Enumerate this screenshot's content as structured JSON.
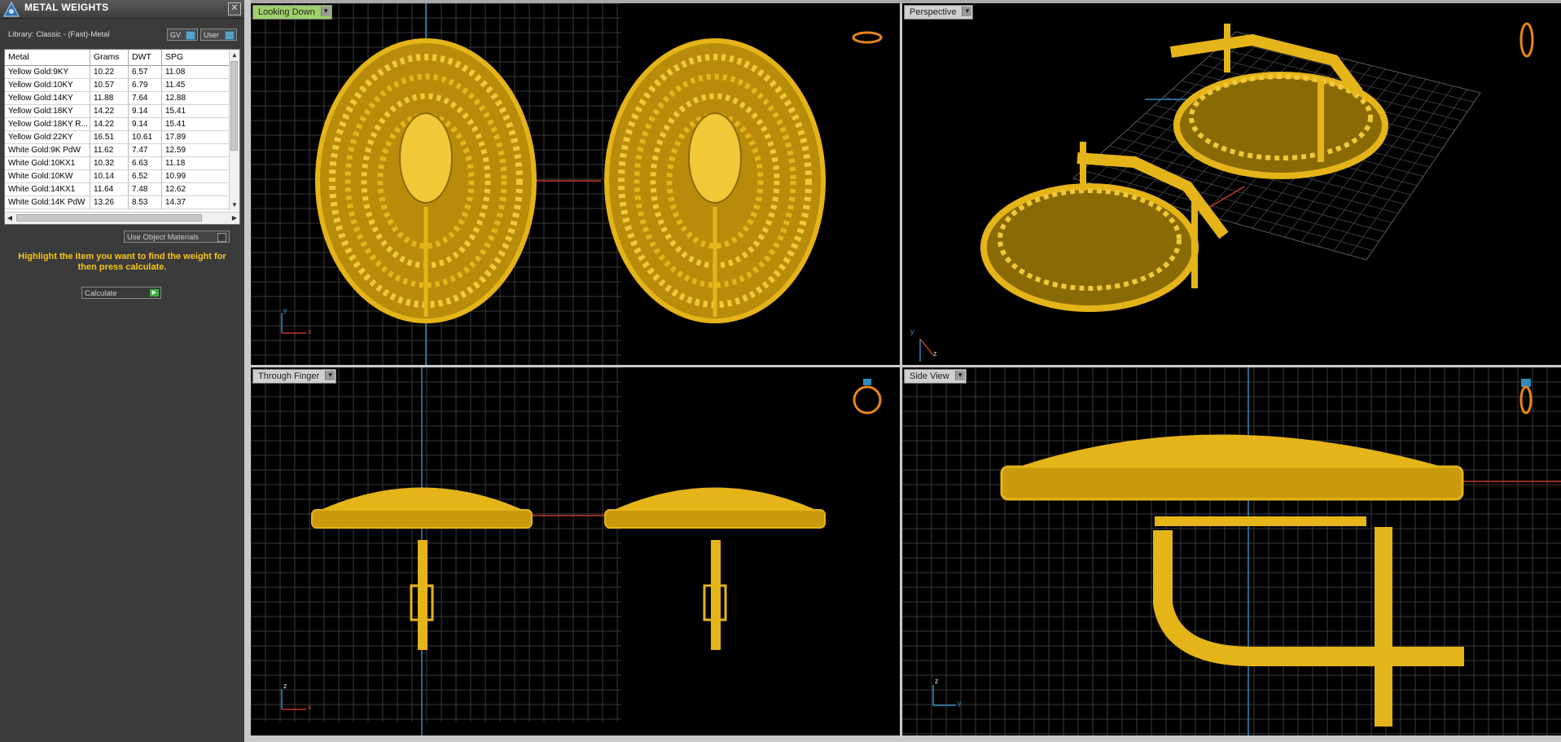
{
  "panel": {
    "title": "METAL WEIGHTS",
    "close_glyph": "✕",
    "library": "Library: Classic - (Fast)-Metal",
    "chips": {
      "gv": "GV",
      "user": "User"
    },
    "columns": [
      "Metal",
      "Grams",
      "DWT",
      "SPG"
    ],
    "rows": [
      [
        "Yellow Gold:9KY",
        "10.22",
        "6.57",
        "11.08"
      ],
      [
        "Yellow Gold:10KY",
        "10.57",
        "6.79",
        "11.45"
      ],
      [
        "Yellow Gold:14KY",
        "11.88",
        "7.64",
        "12.88"
      ],
      [
        "Yellow Gold:18KY",
        "14.22",
        "9.14",
        "15.41"
      ],
      [
        "Yellow Gold:18KY R...",
        "14.22",
        "9.14",
        "15.41"
      ],
      [
        "Yellow Gold:22KY",
        "16.51",
        "10.61",
        "17.89"
      ],
      [
        "White Gold:9K PdW",
        "11.62",
        "7.47",
        "12.59"
      ],
      [
        "White Gold:10KX1",
        "10.32",
        "6.63",
        "11.18"
      ],
      [
        "White Gold:10KW",
        "10.14",
        "6.52",
        "10.99"
      ],
      [
        "White Gold:14KX1",
        "11.64",
        "7.48",
        "12.62"
      ],
      [
        "White Gold:14K PdW",
        "13.26",
        "8.53",
        "14.37"
      ]
    ],
    "use_object_materials": "Use Object Materials",
    "hint": "Highlight the item you want to find the weight for then press calculate.",
    "calculate": "Calculate"
  },
  "viewports": {
    "top_left": {
      "label": "Looking Down",
      "axes": {
        "v": "y",
        "h": "x"
      }
    },
    "top_right": {
      "label": "Perspective",
      "axes": {
        "v": "y",
        "d": "z"
      }
    },
    "bottom_left": {
      "label": "Through Finger",
      "axes": {
        "v": "z",
        "h": "x"
      }
    },
    "bottom_right": {
      "label": "Side View",
      "axes": {
        "v": "z",
        "h": "y"
      }
    }
  },
  "colors": {
    "gold": "#e5b419",
    "gold_dark": "#8a6a05",
    "grid": "#3a3a3a",
    "red_axis": "#c0392b",
    "blue_axis": "#2f8bbd",
    "label_active": "#9ed06a"
  }
}
